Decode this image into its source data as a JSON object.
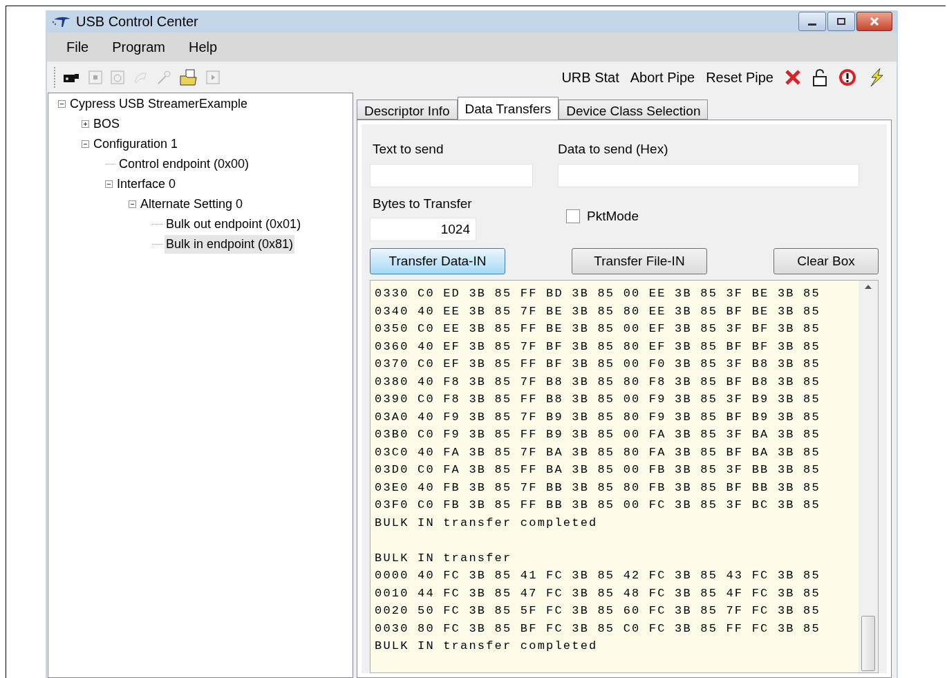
{
  "window": {
    "title": "USB Control Center"
  },
  "menu": [
    "File",
    "Program",
    "Help"
  ],
  "toolbar": {
    "actions": [
      "URB Stat",
      "Abort Pipe",
      "Reset Pipe"
    ]
  },
  "tree": [
    {
      "label": "Cypress USB StreamerExample",
      "expanded": true,
      "selected": false,
      "children": [
        {
          "label": "BOS",
          "expanded": false,
          "selected": false
        },
        {
          "label": "Configuration 1",
          "expanded": true,
          "selected": false,
          "children": [
            {
              "label": "Control endpoint (0x00)",
              "selected": false
            },
            {
              "label": "Interface 0",
              "expanded": true,
              "selected": false,
              "children": [
                {
                  "label": "Alternate Setting 0",
                  "expanded": true,
                  "selected": false,
                  "children": [
                    {
                      "label": "Bulk out endpoint (0x01)",
                      "selected": false
                    },
                    {
                      "label": "Bulk in endpoint (0x81)",
                      "selected": true
                    }
                  ]
                }
              ]
            }
          ]
        }
      ]
    }
  ],
  "tabs": [
    {
      "label": "Descriptor Info",
      "selected": false
    },
    {
      "label": "Data Transfers",
      "selected": true
    },
    {
      "label": "Device Class Selection",
      "selected": false
    }
  ],
  "text_to_send": {
    "label": "Text to send"
  },
  "data_to_send": {
    "label": "Data to send (Hex)"
  },
  "bytes_to_transfer": {
    "label": "Bytes to Transfer",
    "value": "1024"
  },
  "pkt_mode": {
    "label": "PktMode",
    "checked": false
  },
  "buttons": [
    {
      "label": "Transfer Data-IN",
      "selected": true
    },
    {
      "label": "Transfer File-IN",
      "selected": false
    },
    {
      "label": "Clear Box",
      "selected": false
    }
  ],
  "log": [
    {
      "lines": [
        "0330 C0 ED 3B 85 FF BD 3B 85 00 EE 3B 85 3F BE 3B 85",
        "0340 40 EE 3B 85 7F BE 3B 85 80 EE 3B 85 BF BE 3B 85",
        "0350 C0 EE 3B 85 FF BE 3B 85 00 EF 3B 85 3F BF 3B 85",
        "0360 40 EF 3B 85 7F BF 3B 85 80 EF 3B 85 BF BF 3B 85",
        "0370 C0 EF 3B 85 FF BF 3B 85 00 F0 3B 85 3F B8 3B 85",
        "0380 40 F8 3B 85 7F B8 3B 85 80 F8 3B 85 BF B8 3B 85",
        "0390 C0 F8 3B 85 FF B8 3B 85 00 F9 3B 85 3F B9 3B 85",
        "03A0 40 F9 3B 85 7F B9 3B 85 80 F9 3B 85 BF B9 3B 85",
        "03B0 C0 F9 3B 85 FF B9 3B 85 00 FA 3B 85 3F BA 3B 85",
        "03C0 40 FA 3B 85 7F BA 3B 85 80 FA 3B 85 BF BA 3B 85",
        "03D0 C0 FA 3B 85 FF BA 3B 85 00 FB 3B 85 3F BB 3B 85",
        "03E0 40 FB 3B 85 7F BB 3B 85 80 FB 3B 85 BF BB 3B 85",
        "03F0 C0 FB 3B 85 FF BB 3B 85 00 FC 3B 85 3F BC 3B 85",
        "BULK IN transfer completed"
      ]
    },
    {
      "lines": [
        "BULK IN transfer",
        "0000 40 FC 3B 85 41 FC 3B 85 42 FC 3B 85 43 FC 3B 85",
        "0010 44 FC 3B 85 47 FC 3B 85 48 FC 3B 85 4F FC 3B 85",
        "0020 50 FC 3B 85 5F FC 3B 85 60 FC 3B 85 7F FC 3B 85",
        "0030 80 FC 3B 85 BF FC 3B 85 C0 FC 3B 85 FF FC 3B 85",
        "BULK IN transfer completed"
      ]
    }
  ]
}
